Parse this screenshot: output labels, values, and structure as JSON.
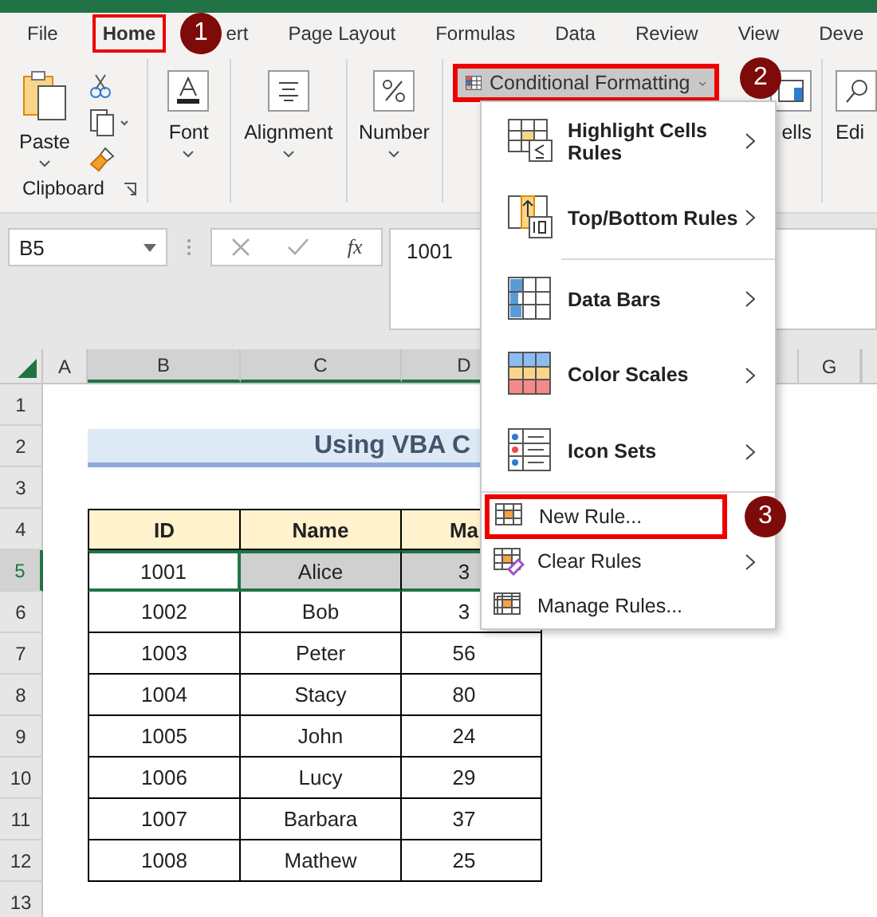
{
  "tabs": [
    {
      "label": "File",
      "selected": false
    },
    {
      "label": "Home",
      "selected": true,
      "callout": "1"
    },
    {
      "label": "ert",
      "selected": false
    },
    {
      "label": "Page Layout",
      "selected": false
    },
    {
      "label": "Formulas",
      "selected": false
    },
    {
      "label": "Data",
      "selected": false
    },
    {
      "label": "Review",
      "selected": false
    },
    {
      "label": "View",
      "selected": false
    },
    {
      "label": "Deve",
      "selected": false
    }
  ],
  "ribbon": {
    "clipboard": {
      "paste_label": "Paste",
      "group_label": "Clipboard"
    },
    "groups": [
      {
        "label": "Font",
        "kind": "font"
      },
      {
        "label": "Alignment",
        "kind": "alignment"
      },
      {
        "label": "Number",
        "kind": "number"
      }
    ],
    "conditional_formatting": {
      "label": "Conditional Formatting",
      "expanded": true,
      "callout": "2"
    },
    "cells_label": "ells",
    "editing_label": "Edi"
  },
  "formula_bar": {
    "name_box": "B5",
    "function_label": "fx",
    "value": "1001"
  },
  "sheet": {
    "columns": [
      {
        "label": "A",
        "selected": false
      },
      {
        "label": "B",
        "selected": true
      },
      {
        "label": "C",
        "selected": true
      },
      {
        "label": "D",
        "selected": true
      },
      {
        "label": "G",
        "selected": false
      }
    ],
    "rows": [
      {
        "number": "1",
        "selected": false,
        "kind": "blank"
      },
      {
        "number": "2",
        "selected": false,
        "kind": "title",
        "text": "Using VBA C"
      },
      {
        "number": "3",
        "selected": false,
        "kind": "blank"
      },
      {
        "number": "4",
        "selected": false,
        "kind": "header",
        "cells": [
          "ID",
          "Name",
          "Ma"
        ]
      },
      {
        "number": "5",
        "selected": true,
        "kind": "data",
        "cells": [
          {
            "text": "1001",
            "selected": true,
            "active": true
          },
          {
            "text": "Alice",
            "selected": true,
            "active": false
          },
          {
            "text": "3",
            "selected": true,
            "active": false
          }
        ]
      },
      {
        "number": "6",
        "selected": false,
        "kind": "data",
        "cells": [
          {
            "text": "1002",
            "selected": false,
            "active": false
          },
          {
            "text": "Bob",
            "selected": false,
            "active": false
          },
          {
            "text": "3",
            "selected": false,
            "active": false
          }
        ]
      },
      {
        "number": "7",
        "selected": false,
        "kind": "data",
        "cells": [
          {
            "text": "1003",
            "selected": false,
            "active": false
          },
          {
            "text": "Peter",
            "selected": false,
            "active": false
          },
          {
            "text": "56",
            "selected": false,
            "active": false
          }
        ]
      },
      {
        "number": "8",
        "selected": false,
        "kind": "data",
        "cells": [
          {
            "text": "1004",
            "selected": false,
            "active": false
          },
          {
            "text": "Stacy",
            "selected": false,
            "active": false
          },
          {
            "text": "80",
            "selected": false,
            "active": false
          }
        ]
      },
      {
        "number": "9",
        "selected": false,
        "kind": "data",
        "cells": [
          {
            "text": "1005",
            "selected": false,
            "active": false
          },
          {
            "text": "John",
            "selected": false,
            "active": false
          },
          {
            "text": "24",
            "selected": false,
            "active": false
          }
        ]
      },
      {
        "number": "10",
        "selected": false,
        "kind": "data",
        "cells": [
          {
            "text": "1006",
            "selected": false,
            "active": false
          },
          {
            "text": "Lucy",
            "selected": false,
            "active": false
          },
          {
            "text": "29",
            "selected": false,
            "active": false
          }
        ]
      },
      {
        "number": "11",
        "selected": false,
        "kind": "data",
        "cells": [
          {
            "text": "1007",
            "selected": false,
            "active": false
          },
          {
            "text": "Barbara",
            "selected": false,
            "active": false
          },
          {
            "text": "37",
            "selected": false,
            "active": false
          }
        ]
      },
      {
        "number": "12",
        "selected": false,
        "kind": "data",
        "cells": [
          {
            "text": "1008",
            "selected": false,
            "active": false
          },
          {
            "text": "Mathew",
            "selected": false,
            "active": false
          },
          {
            "text": "25",
            "selected": false,
            "active": false
          }
        ]
      },
      {
        "number": "13",
        "selected": false,
        "kind": "blank"
      }
    ]
  },
  "menu": {
    "items": [
      {
        "kind": "large",
        "label": "Highlight Cells Rules",
        "submenu": true
      },
      {
        "kind": "large",
        "label": "Top/Bottom Rules",
        "submenu": true
      },
      {
        "kind": "separator"
      },
      {
        "kind": "large",
        "label": "Data Bars",
        "submenu": true
      },
      {
        "kind": "large",
        "label": "Color Scales",
        "submenu": true
      },
      {
        "kind": "large",
        "label": "Icon Sets",
        "submenu": true
      },
      {
        "kind": "separator"
      },
      {
        "kind": "small",
        "label": "New Rule...",
        "submenu": false,
        "callout": "3"
      },
      {
        "kind": "small",
        "label": "Clear Rules",
        "submenu": true
      },
      {
        "kind": "small",
        "label": "Manage Rules...",
        "submenu": false
      }
    ]
  }
}
